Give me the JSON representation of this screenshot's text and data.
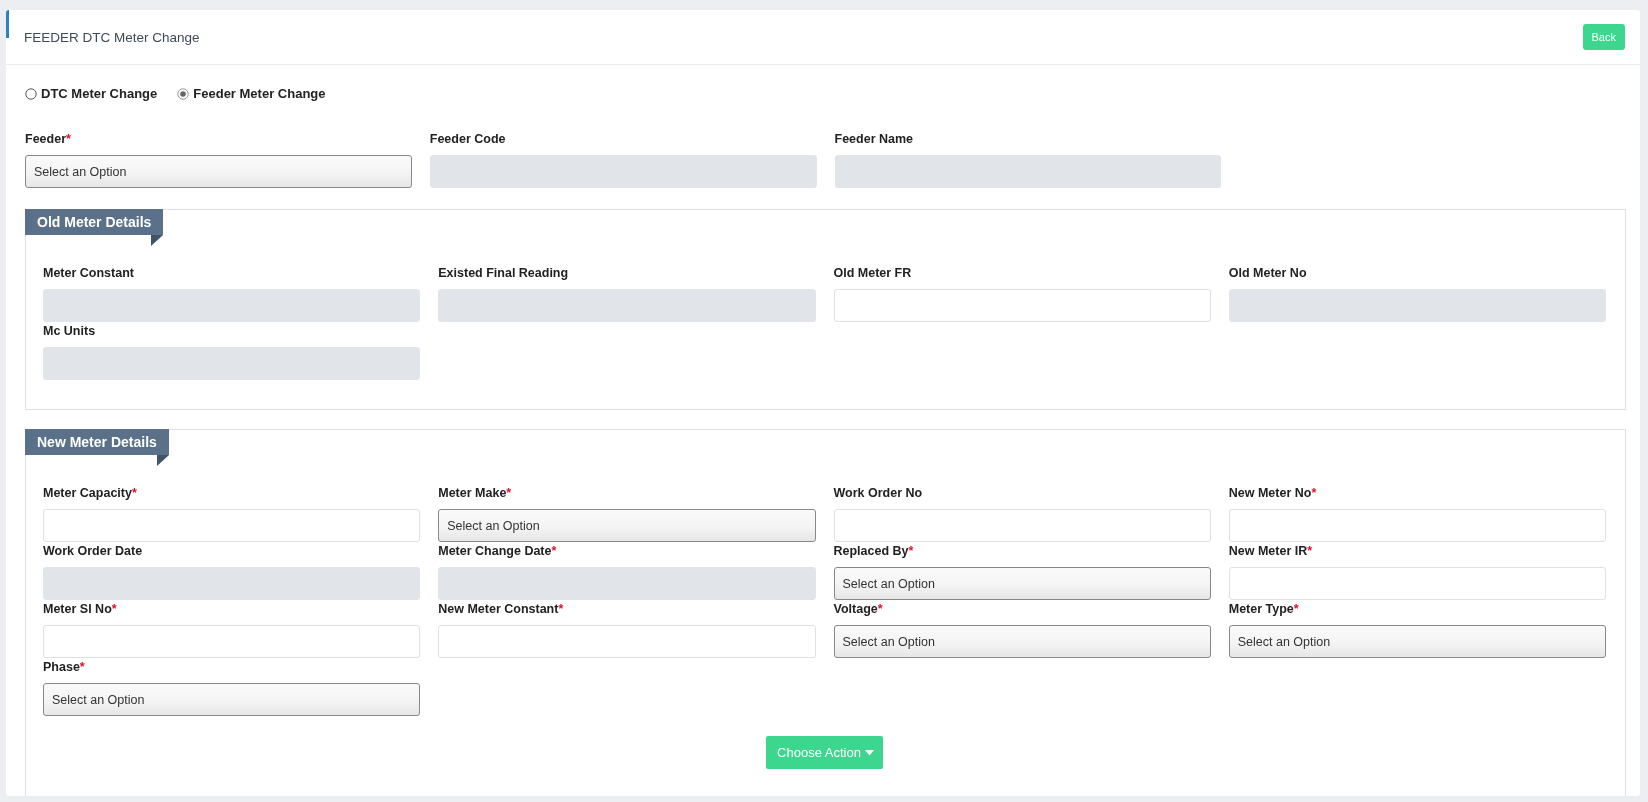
{
  "page": {
    "title": "FEEDER DTC Meter Change",
    "back_button": "Back"
  },
  "required_marker": "*",
  "mode_options": [
    {
      "label": "DTC Meter Change",
      "selected": false
    },
    {
      "label": "Feeder Meter Change",
      "selected": true
    }
  ],
  "feeder_fields": [
    {
      "label": "Feeder",
      "required": true,
      "kind": "select",
      "value": "Select an Option"
    },
    {
      "label": "Feeder Code",
      "required": false,
      "kind": "text",
      "disabled": true
    },
    {
      "label": "Feeder Name",
      "required": false,
      "kind": "text",
      "disabled": true
    }
  ],
  "sections": [
    {
      "title": "Old Meter Details",
      "fields": [
        {
          "label": "Meter Constant",
          "required": false,
          "kind": "text",
          "disabled": true
        },
        {
          "label": "Existed Final Reading",
          "required": false,
          "kind": "text",
          "disabled": true
        },
        {
          "label": "Old Meter FR",
          "required": false,
          "kind": "text",
          "disabled": false
        },
        {
          "label": "Old Meter No",
          "required": false,
          "kind": "text",
          "disabled": true
        },
        {
          "label": "Mc Units",
          "required": false,
          "kind": "text",
          "disabled": true
        }
      ]
    },
    {
      "title": "New Meter Details",
      "fields": [
        {
          "label": "Meter Capacity",
          "required": true,
          "kind": "text",
          "disabled": false
        },
        {
          "label": "Meter Make",
          "required": true,
          "kind": "select",
          "value": "Select an Option"
        },
        {
          "label": "Work Order No",
          "required": false,
          "kind": "text",
          "disabled": false
        },
        {
          "label": "New Meter No",
          "required": true,
          "kind": "text",
          "disabled": false
        },
        {
          "label": "Work Order Date",
          "required": false,
          "kind": "text",
          "disabled": true
        },
        {
          "label": "Meter Change Date",
          "required": true,
          "kind": "text",
          "disabled": true
        },
        {
          "label": "Replaced By",
          "required": true,
          "kind": "select",
          "value": "Select an Option"
        },
        {
          "label": "New Meter IR",
          "required": true,
          "kind": "text",
          "disabled": false
        },
        {
          "label": "Meter Sl No",
          "required": true,
          "kind": "text",
          "disabled": false
        },
        {
          "label": "New Meter Constant",
          "required": true,
          "kind": "text",
          "disabled": false
        },
        {
          "label": "Voltage",
          "required": true,
          "kind": "select",
          "value": "Select an Option"
        },
        {
          "label": "Meter Type",
          "required": true,
          "kind": "select",
          "value": "Select an Option"
        },
        {
          "label": "Phase",
          "required": true,
          "kind": "select",
          "value": "Select an Option"
        }
      ],
      "action_button": "Choose Action"
    }
  ]
}
